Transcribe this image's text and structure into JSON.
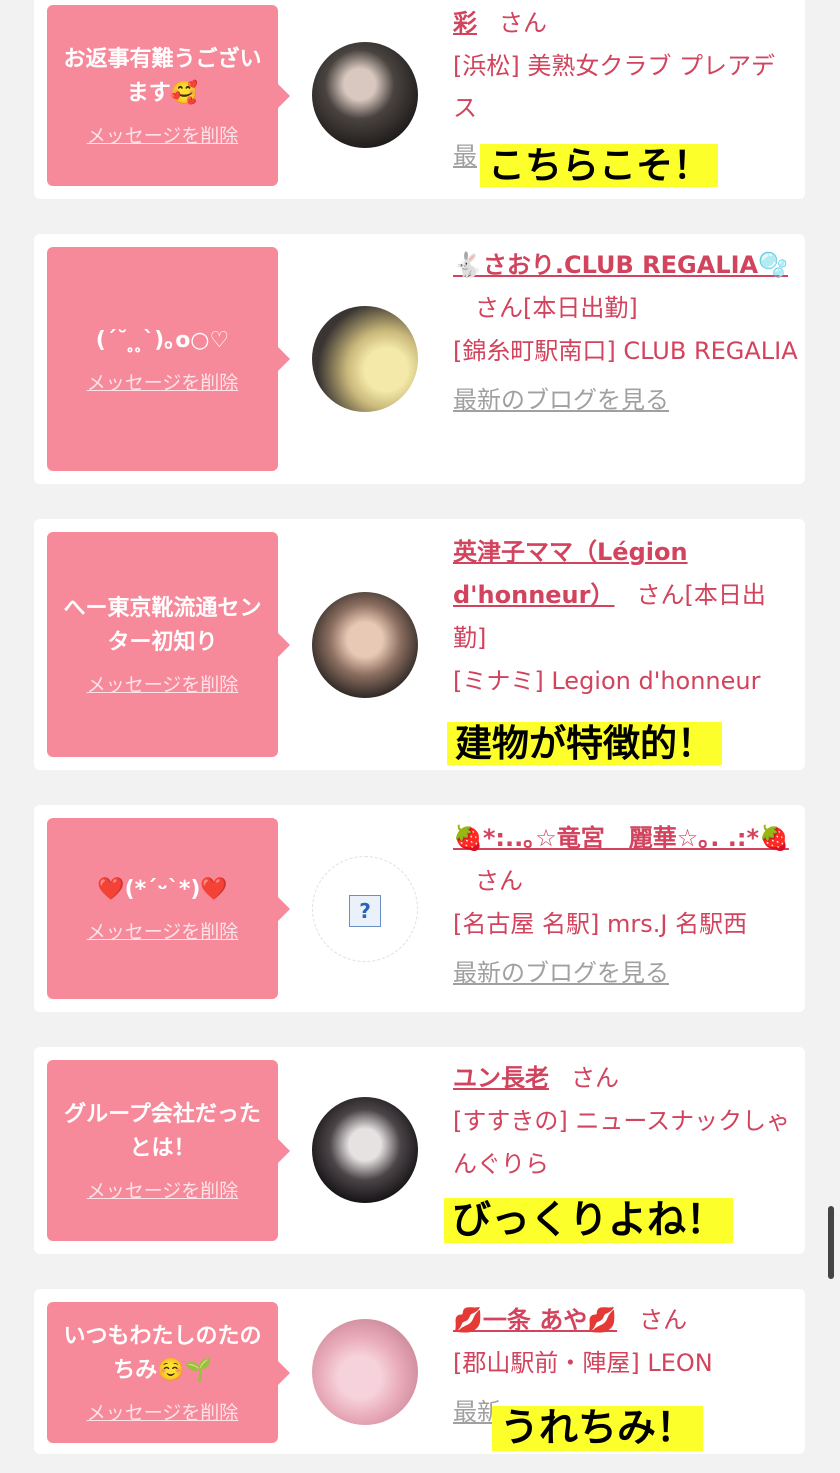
{
  "delete_label": "メッセージを削除",
  "blog_label": "最新のブログを見る",
  "san_label": "さん",
  "cards": [
    {
      "message": "お返事有難うございます🥰",
      "name": "彩",
      "shop": "[浜松] 美熟女クラブ プレアデス",
      "blog_partial": "最",
      "overlay": "こちらこそ！"
    },
    {
      "message": "(ˊ˘ ̥ ̥ˋ)｡o○♡",
      "name": "🐇さおり.CLUB REGALIA🫧",
      "tag": "[本日出勤]",
      "shop": "[錦糸町駅南口] CLUB REGALIA"
    },
    {
      "message": "へー東京靴流通センター初知り",
      "name": "英津子ママ（Légion d'honneur）",
      "tag": "[本日出勤]",
      "shop": "[ミナミ] Legion d'honneur",
      "overlay": "建物が特徴的！"
    },
    {
      "message": "❤️(*ˊᵕˋ*)❤️",
      "name": "🍓*:..｡☆竜宮　麗華☆｡. .:*🍓",
      "shop": "[名古屋 名駅] mrs.J 名駅西"
    },
    {
      "message": "グループ会社だったとは！",
      "name": "ユン長老",
      "shop": "[すすきの] ニュースナックしゃんぐりら",
      "overlay": "びっくりよね！"
    },
    {
      "message": "いつもわたしのたのちみ☺️🌱",
      "name": "💋一条 あや💋",
      "shop": "[郡山駅前・陣屋] LEON",
      "blog_partial": "最新",
      "overlay": "うれちみ！"
    }
  ]
}
